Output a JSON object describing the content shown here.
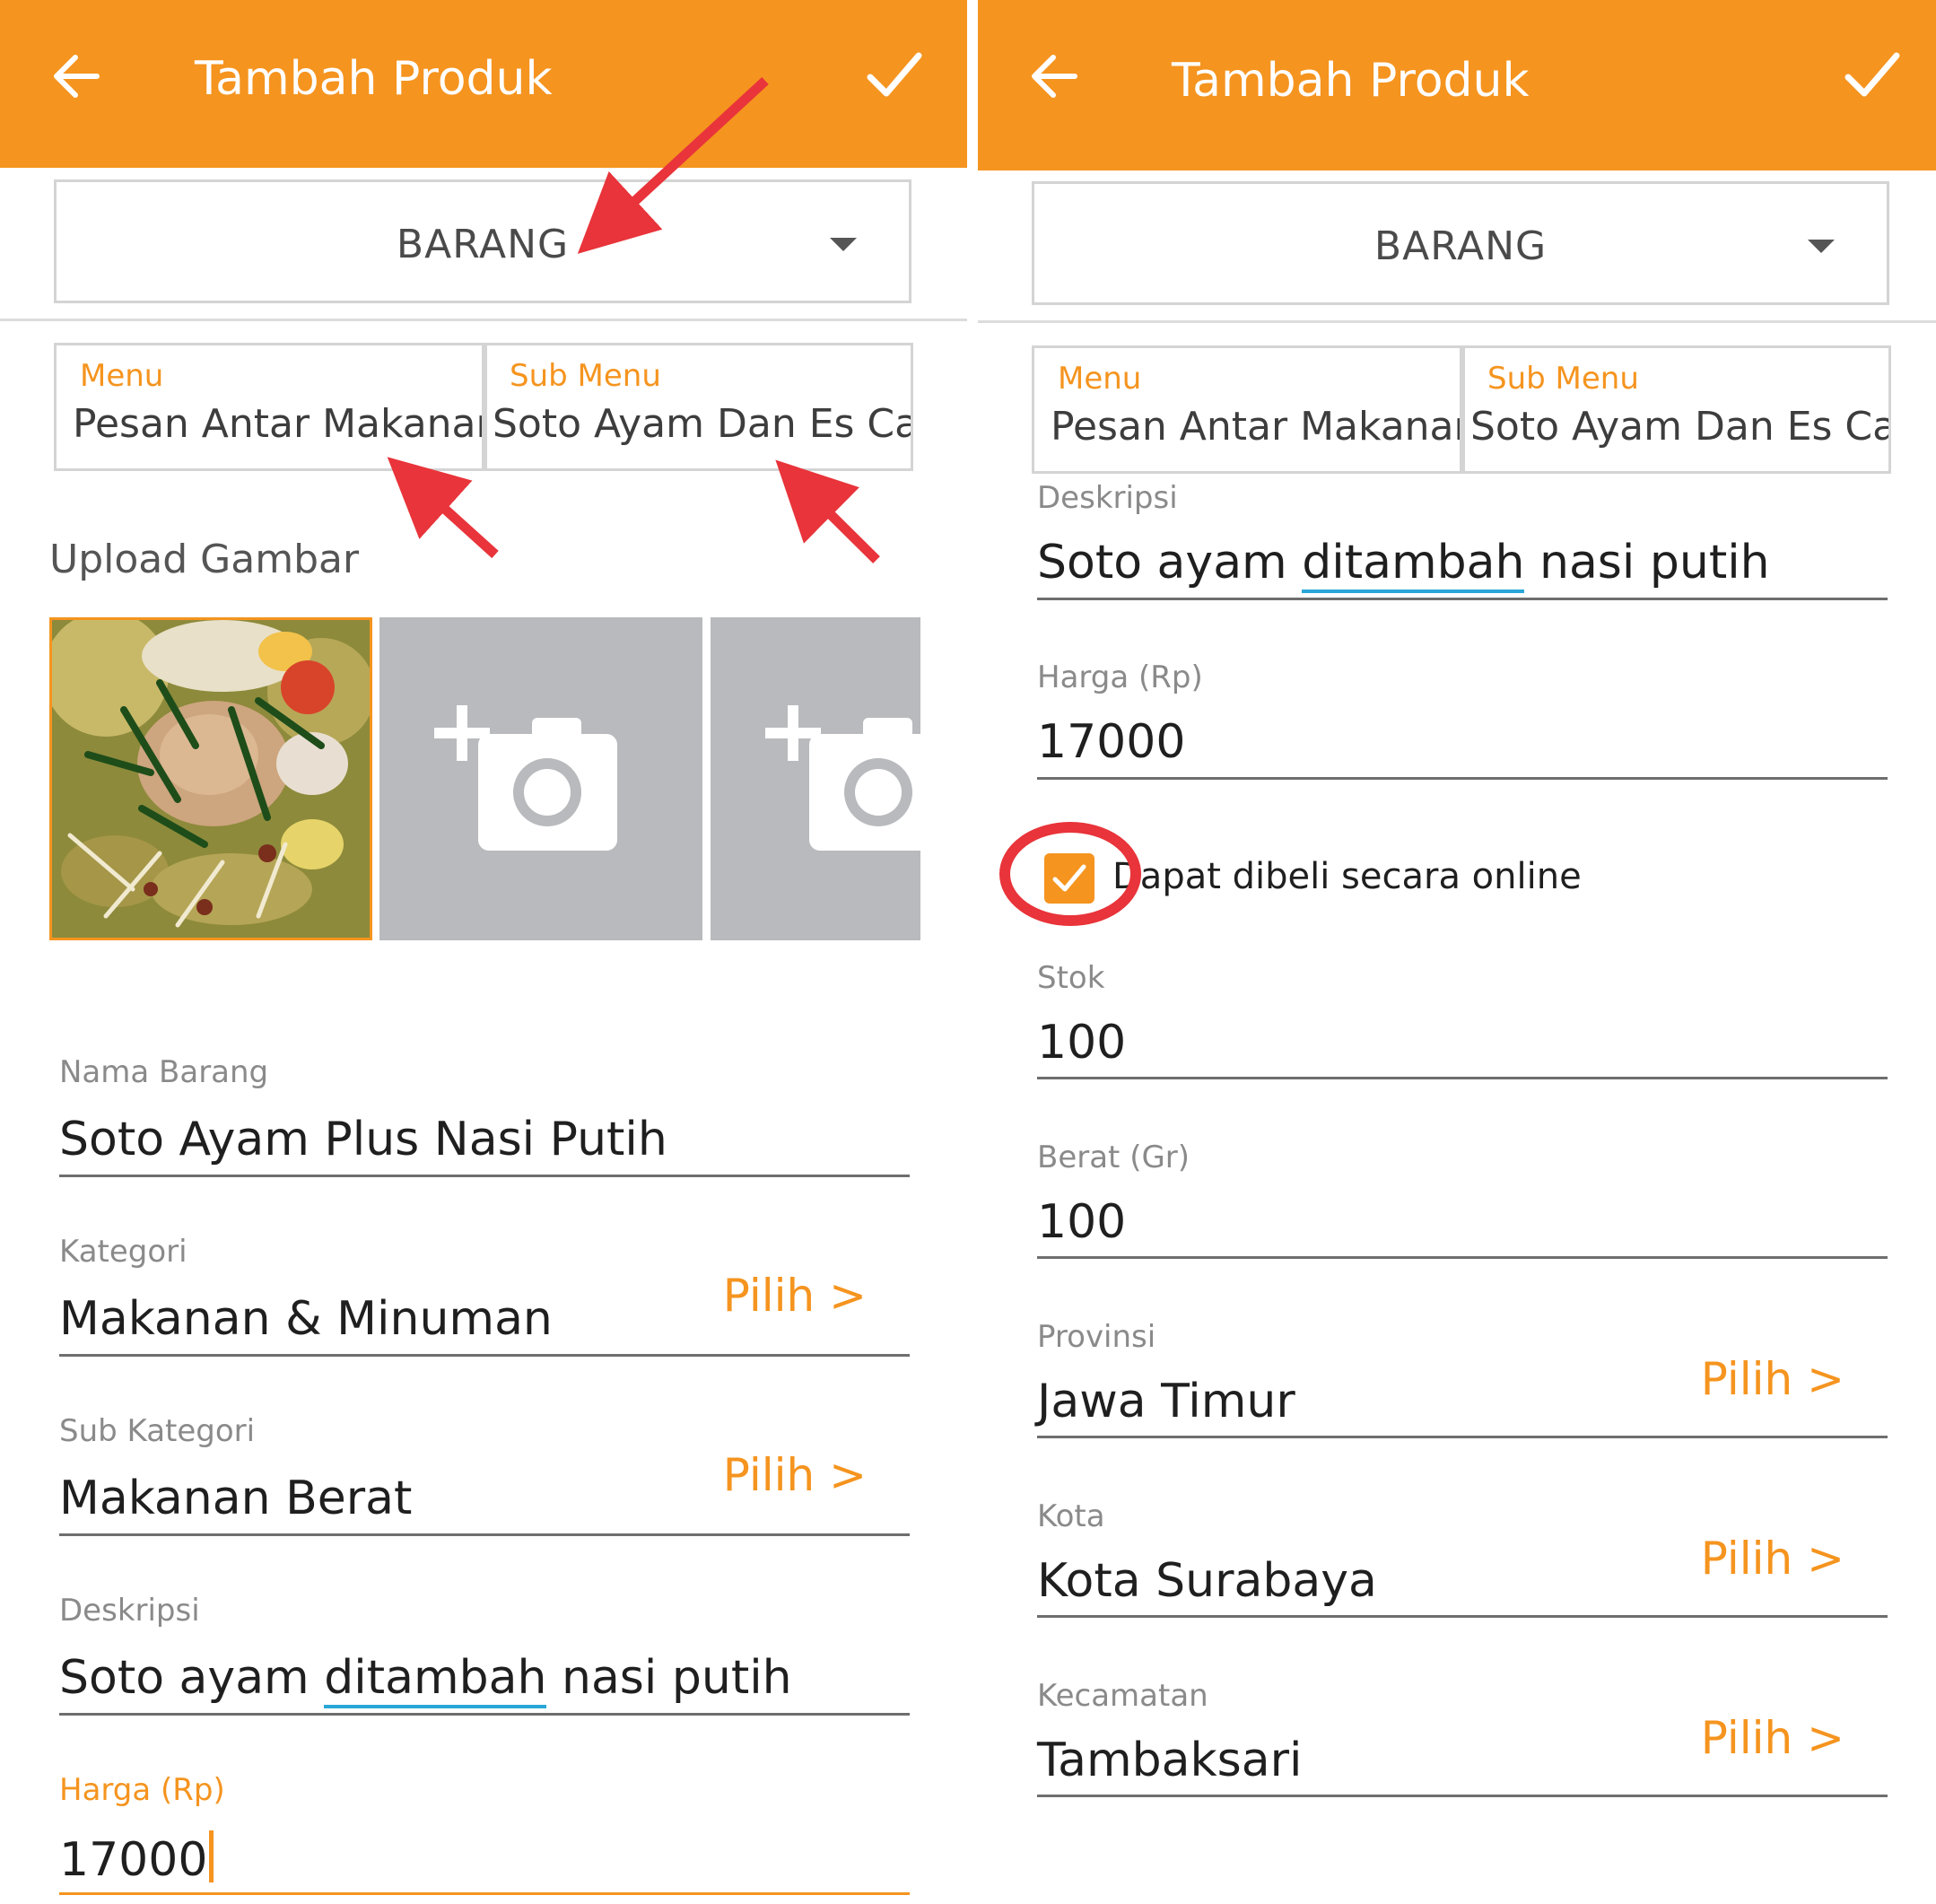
{
  "left": {
    "appbar": {
      "title": "Tambah Produk",
      "icons": [
        "arrow-back-icon",
        "check-icon"
      ]
    },
    "type_select": {
      "value": "BARANG"
    },
    "menu": {
      "label": "Menu",
      "value": "Pesan Antar Makanan"
    },
    "sub_menu": {
      "label": "Sub Menu",
      "value": "Soto Ayam Dan Es Ca..."
    },
    "upload": {
      "title": "Upload Gambar"
    },
    "fields": {
      "nama_barang": {
        "label": "Nama Barang",
        "value": "Soto Ayam Plus Nasi Putih"
      },
      "kategori": {
        "label": "Kategori",
        "value": "Makanan & Minuman",
        "action": "Pilih >"
      },
      "sub_kategori": {
        "label": "Sub Kategori",
        "value": "Makanan Berat",
        "action": "Pilih >"
      },
      "deskripsi": {
        "label": "Deskripsi",
        "value_a": "Soto ayam ",
        "value_b": "ditambah",
        "value_c": " nasi putih"
      },
      "harga": {
        "label": "Harga (Rp)",
        "value": "17000"
      }
    }
  },
  "right": {
    "appbar": {
      "title": "Tambah Produk",
      "icons": [
        "arrow-back-icon",
        "check-icon"
      ]
    },
    "type_select": {
      "value": "BARANG"
    },
    "menu": {
      "label": "Menu",
      "value": "Pesan Antar Makanan"
    },
    "sub_menu": {
      "label": "Sub Menu",
      "value": "Soto Ayam Dan Es Ca..."
    },
    "fields": {
      "deskripsi": {
        "label": "Deskripsi",
        "value_a": "Soto ayam ",
        "value_b": "ditambah",
        "value_c": " nasi putih"
      },
      "harga": {
        "label": "Harga (Rp)",
        "value": "17000"
      },
      "online": {
        "label": "Dapat dibeli secara online",
        "checked": true
      },
      "stok": {
        "label": "Stok",
        "value": "100"
      },
      "berat": {
        "label": "Berat (Gr)",
        "value": "100"
      },
      "provinsi": {
        "label": "Provinsi",
        "value": "Jawa Timur",
        "action": "Pilih >"
      },
      "kota": {
        "label": "Kota",
        "value": "Kota Surabaya",
        "action": "Pilih >"
      },
      "kecamatan": {
        "label": "Kecamatan",
        "value": "Tambaksari",
        "action": "Pilih >"
      }
    }
  },
  "colors": {
    "accent": "#f5941f",
    "annotation": "#e8343a",
    "spellcheck": "#2aa7d8"
  }
}
